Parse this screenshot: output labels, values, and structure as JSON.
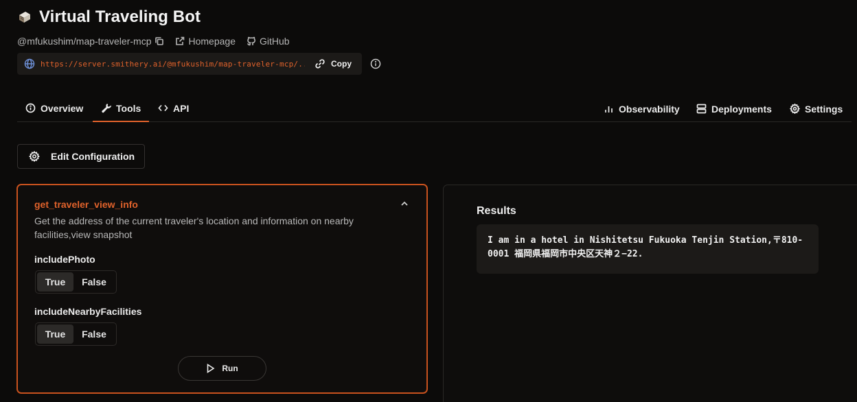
{
  "header": {
    "title": "Virtual Traveling Bot",
    "package": "@mfukushim/map-traveler-mcp",
    "homepage_label": "Homepage",
    "github_label": "GitHub",
    "url": "https://server.smithery.ai/@mfukushim/map-traveler-mcp/...",
    "copy_label": "Copy"
  },
  "tabs": {
    "overview": "Overview",
    "tools": "Tools",
    "api": "API",
    "observability": "Observability",
    "deployments": "Deployments",
    "settings": "Settings",
    "active": "Tools"
  },
  "edit_config_label": "Edit Configuration",
  "tool": {
    "name": "get_traveler_view_info",
    "description": "Get the address of the current traveler's location and information on nearby facilities,view snapshot",
    "params": [
      {
        "label": "includePhoto",
        "true_label": "True",
        "false_label": "False",
        "selected": "True"
      },
      {
        "label": "includeNearbyFacilities",
        "true_label": "True",
        "false_label": "False",
        "selected": "True"
      }
    ],
    "run_label": "Run"
  },
  "results": {
    "title": "Results",
    "text": "I am in a hotel in Nishitetsu Fukuoka Tenjin Station,〒810-0001 福岡県福岡市中央区天神２−22."
  },
  "colors": {
    "accent": "#e1622b",
    "background": "#0c0b0a",
    "panel": "#1c1a18"
  }
}
